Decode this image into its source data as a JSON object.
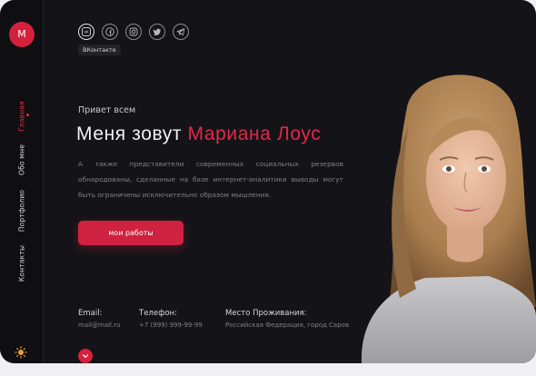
{
  "sidebar": {
    "logo_letter": "M",
    "nav": [
      {
        "label": "Главная",
        "active": true
      },
      {
        "label": "Обо мне",
        "active": false
      },
      {
        "label": "Портфолио",
        "active": false
      },
      {
        "label": "Контакты",
        "active": false
      }
    ],
    "theme_icon": "sun-icon"
  },
  "social": {
    "icons": [
      "vk-icon",
      "facebook-icon",
      "instagram-icon",
      "twitter-icon",
      "telegram-icon"
    ],
    "tooltip": "ВКонтакте"
  },
  "hero": {
    "greeting": "Привет всем",
    "headline_prefix": "Меня зовут",
    "headline_name": "Мариана Лоус",
    "description": "А также представители современных социальных резервов обнародованы, сделанные на базе интернет-аналитики выводы могут быть ограничены исключительно образом мышления.",
    "cta_label": "мои работы"
  },
  "contacts": {
    "email_label": "Email:",
    "email_value": "mail@mail.ru",
    "phone_label": "Телефон:",
    "phone_value": "+7 (999) 999-99-99",
    "location_label": "Место Проживания:",
    "location_value": "Российская Федерация, город Саров"
  },
  "colors": {
    "accent": "#d4213d",
    "background": "#141418",
    "sidebar": "#0f0f12",
    "muted_text": "#7f7f87"
  }
}
